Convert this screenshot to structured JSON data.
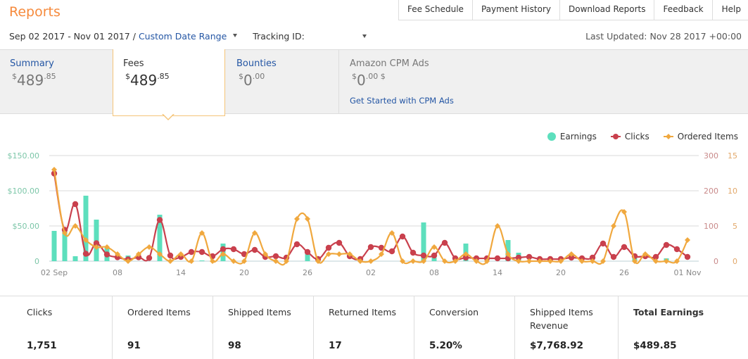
{
  "header": {
    "title": "Reports",
    "nav": [
      "Fee Schedule",
      "Payment History",
      "Download Reports",
      "Feedback",
      "Help"
    ]
  },
  "filters": {
    "date_range": "Sep 02 2017 - Nov 01 2017 /",
    "date_range_link": "Custom Date Range",
    "tracking_label": "Tracking ID:",
    "tracking_value": "",
    "last_updated": "Last Updated: Nov 28 2017 +00:00"
  },
  "summary_tabs": [
    {
      "label": "Summary",
      "currency": "$",
      "whole": "489",
      "cents": ".85",
      "suffix": ""
    },
    {
      "label": "Fees",
      "currency": "$",
      "whole": "489",
      "cents": ".85",
      "suffix": "",
      "selected": true
    },
    {
      "label": "Bounties",
      "currency": "$",
      "whole": "0",
      "cents": ".00",
      "suffix": ""
    },
    {
      "label": "Amazon CPM Ads",
      "currency": "$",
      "whole": "0",
      "cents": ".00",
      "suffix": " $",
      "cta": "Get Started with CPM Ads"
    }
  ],
  "colors": {
    "earnings": "#5ddfbd",
    "clicks": "#c9404d",
    "ordered": "#f0a83e",
    "accent": "#f68a3c",
    "link": "#2456a4"
  },
  "chart_data": {
    "type": "bar+line",
    "legend": [
      "Earnings",
      "Clicks",
      "Ordered Items"
    ],
    "legend_position": "top-right",
    "x_start": "02 Sep 2017",
    "x_end": "01 Nov 2017",
    "x_tick_labels": [
      "02 Sep",
      "08",
      "14",
      "20",
      "26",
      "02",
      "08",
      "14",
      "20",
      "26",
      "01 Nov"
    ],
    "x_tick_day_index": [
      0,
      6,
      12,
      18,
      24,
      30,
      36,
      42,
      48,
      54,
      60
    ],
    "y_left": {
      "label": "Earnings",
      "ticks": [
        "0",
        "$50.00",
        "$100.00",
        "$150.00"
      ],
      "range": [
        0,
        150
      ]
    },
    "y_right_clicks": {
      "ticks": [
        "0",
        "100",
        "200",
        "300"
      ],
      "range": [
        0,
        300
      ]
    },
    "y_right_ordered": {
      "ticks": [
        "0",
        "5",
        "10",
        "15"
      ],
      "range": [
        0,
        15
      ]
    },
    "grid": true,
    "series": [
      {
        "name": "Earnings",
        "type": "bar",
        "axis": "left",
        "values": [
          43,
          43,
          7,
          93,
          59,
          19,
          0,
          8,
          0,
          0,
          66,
          0,
          0,
          0,
          1,
          0,
          25,
          0,
          0,
          0,
          0,
          0,
          0,
          0,
          12,
          0,
          0,
          0,
          0,
          0,
          0,
          0,
          0,
          0,
          0,
          55,
          5,
          0,
          0,
          25,
          0,
          0,
          0,
          30,
          12,
          0,
          0,
          0,
          0,
          0,
          0,
          0,
          0,
          0,
          0,
          10,
          0,
          0,
          4,
          0,
          0
        ]
      },
      {
        "name": "Clicks",
        "type": "line",
        "axis": "right_clicks",
        "values": [
          249,
          89,
          162,
          21,
          51,
          19,
          11,
          5,
          11,
          9,
          117,
          16,
          12,
          26,
          26,
          14,
          34,
          34,
          20,
          32,
          12,
          14,
          10,
          48,
          26,
          6,
          38,
          52,
          14,
          6,
          40,
          38,
          28,
          70,
          24,
          16,
          16,
          52,
          8,
          10,
          8,
          8,
          8,
          8,
          10,
          12,
          6,
          6,
          6,
          10,
          8,
          10,
          50,
          12,
          40,
          14,
          14,
          12,
          46,
          34,
          12
        ]
      },
      {
        "name": "Ordered Items",
        "type": "line",
        "axis": "right_ordered",
        "values": [
          13,
          4,
          5,
          3,
          2,
          2,
          1,
          0,
          1,
          2,
          1,
          0,
          1,
          0,
          4,
          0,
          1,
          0,
          0,
          4,
          1,
          0,
          0,
          6,
          6,
          0,
          1,
          1,
          1,
          0,
          0,
          1,
          4,
          0,
          0,
          0,
          2,
          0,
          0,
          1,
          0,
          0,
          5,
          1,
          0,
          0,
          0,
          0,
          0,
          1,
          0,
          0,
          0,
          5,
          7,
          0,
          1,
          0,
          0,
          0,
          3
        ]
      }
    ]
  },
  "stats": [
    {
      "label": "Clicks",
      "value": "1,751"
    },
    {
      "label": "Ordered Items",
      "value": "91"
    },
    {
      "label": "Shipped Items",
      "value": "98"
    },
    {
      "label": "Returned Items",
      "value": "17"
    },
    {
      "label": "Conversion",
      "value": "5.20%"
    },
    {
      "label": "Shipped Items Revenue",
      "value": "$7,768.92"
    },
    {
      "label": "Total Earnings",
      "value": "$489.85",
      "bold": true
    }
  ]
}
